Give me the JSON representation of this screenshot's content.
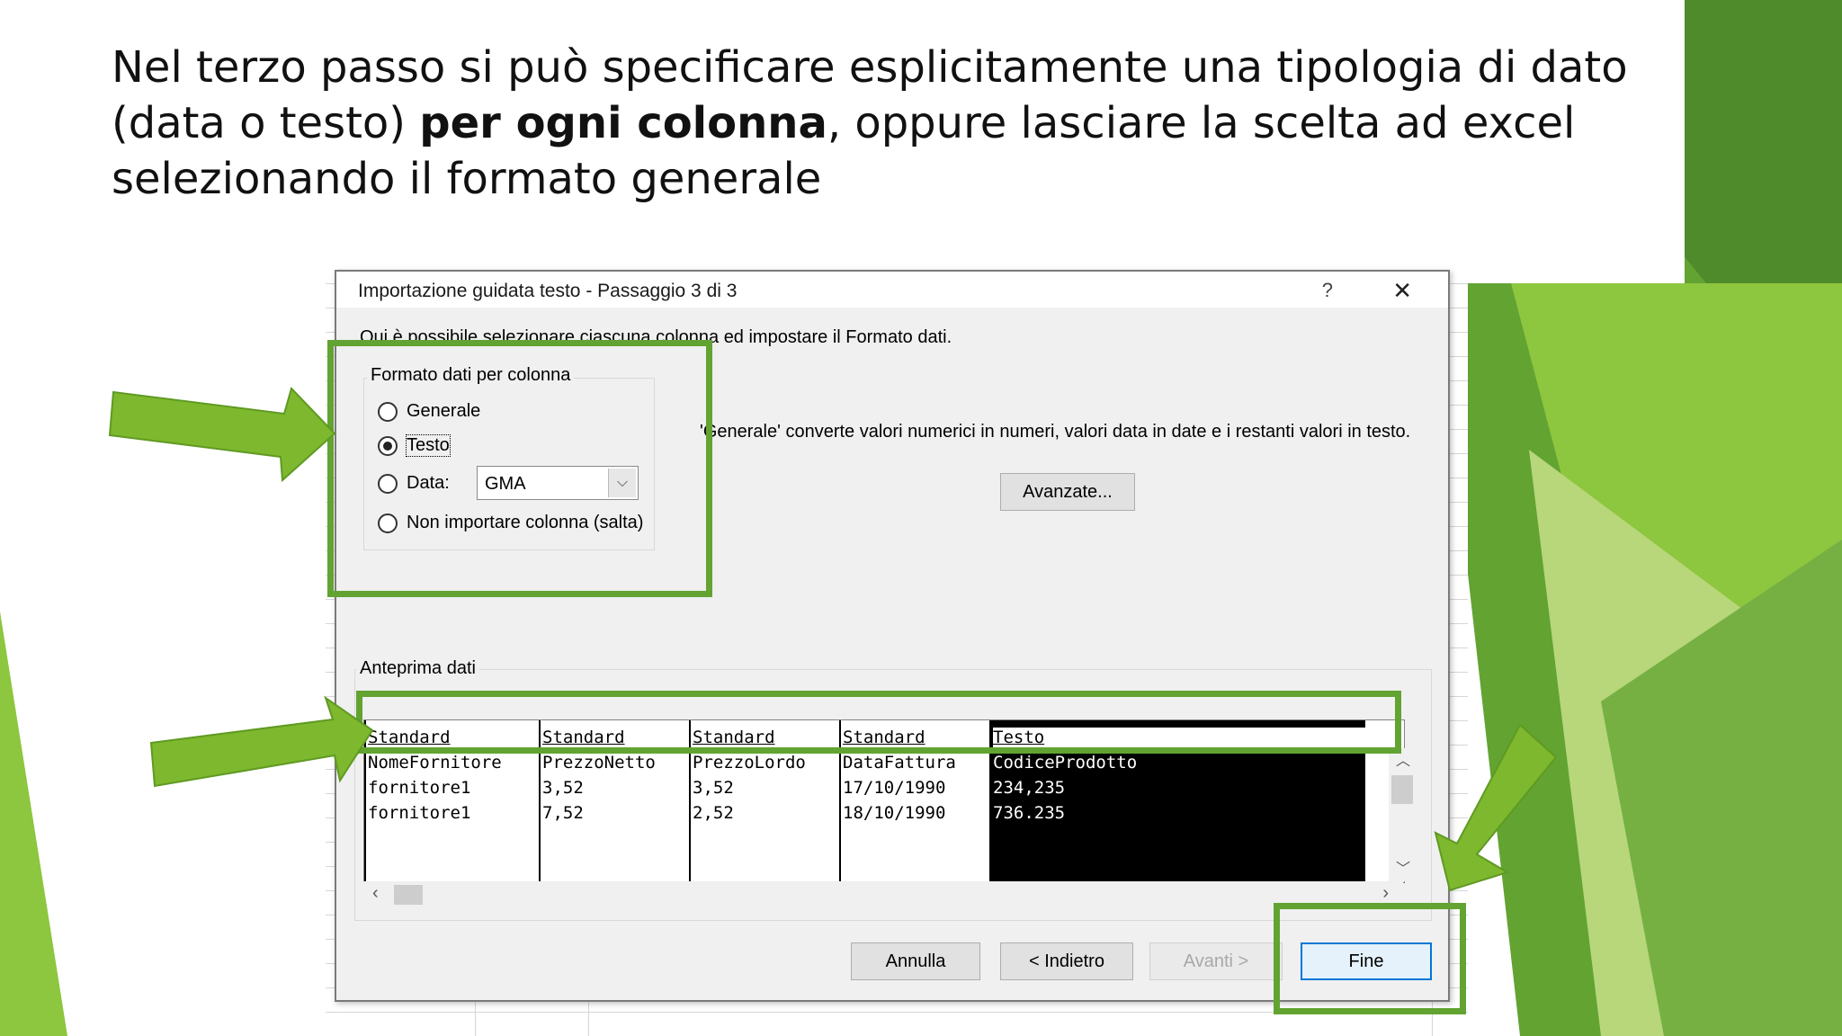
{
  "slide": {
    "caption_line1": "Nel terzo passo si può specificare esplicitamente una tipologia di dato",
    "caption_line2_pre": "(data o testo) ",
    "caption_line2_bold": "per ogni colonna",
    "caption_line2_post": ", oppure lasciare la scelta ad excel",
    "caption_line3": "selezionando il formato generale",
    "accent_colors": [
      "#8dc63f",
      "#62a332",
      "#4f8a2b",
      "#b7d77a"
    ]
  },
  "dialog": {
    "title": "Importazione guidata testo - Passaggio 3 di 3",
    "help_glyph": "?",
    "close_glyph": "✕",
    "intro": "Qui è possibile selezionare ciascuna colonna ed impostare il Formato dati.",
    "format_group": {
      "legend": "Formato dati per colonna",
      "options": [
        {
          "label": "Generale",
          "selected": false
        },
        {
          "label": "Testo",
          "selected": true
        },
        {
          "label": "Data:",
          "selected": false
        },
        {
          "label": "Non importare colonna (salta)",
          "selected": false
        }
      ],
      "date_combo_value": "GMA"
    },
    "description": "'Generale' converte valori numerici in numeri, valori data in date e i restanti valori in testo.",
    "advanced_button": "Avanzate...",
    "preview": {
      "legend": "Anteprima dati",
      "columns": [
        {
          "header": "Standard",
          "rows": [
            "NomeFornitore",
            "fornitore1",
            "fornitore1"
          ]
        },
        {
          "header": "Standard",
          "rows": [
            "PrezzoNetto",
            "3,52",
            "7,52"
          ]
        },
        {
          "header": "Standard",
          "rows": [
            "PrezzoLordo",
            "3,52",
            "2,52"
          ]
        },
        {
          "header": "Standard",
          "rows": [
            "DataFattura",
            "17/10/1990",
            "18/10/1990"
          ]
        },
        {
          "header": "Testo",
          "rows": [
            "CodiceProdotto",
            "234,235",
            "736.235"
          ]
        }
      ]
    },
    "buttons": {
      "cancel": "Annulla",
      "back": "< Indietro",
      "next": "Avanti >",
      "finish": "Fine"
    }
  }
}
